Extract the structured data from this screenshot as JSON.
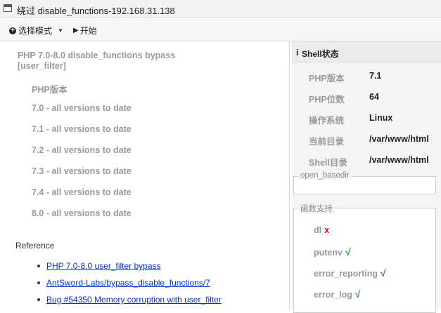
{
  "window": {
    "title": "绕过 disable_functions-192.168.31.138"
  },
  "toolbar": {
    "mode_label": "选择模式",
    "start_label": "开始"
  },
  "left": {
    "plugin_title": "PHP 7.0-8.0 disable_functions bypass [user_filter]",
    "php_version_label": "PHP版本",
    "versions": [
      "7.0 - all versions to date",
      "7.1 - all versions to date",
      "7.2 - all versions to date",
      "7.3 - all versions to date",
      "7.4 - all versions to date",
      "8.0 - all versions to date"
    ],
    "reference_label": "Reference",
    "references": [
      "PHP 7.0-8.0 user_filter bypass",
      "AntSword-Labs/bypass_disable_functions/7",
      "Bug #54350 Memory corruption with user_filter"
    ]
  },
  "right": {
    "header": "Shell状态",
    "info": [
      {
        "label": "PHP版本",
        "value": "7.1"
      },
      {
        "label": "PHP位数",
        "value": "64"
      },
      {
        "label": "操作系统",
        "value": "Linux"
      },
      {
        "label": "当前目录",
        "value": "/var/www/html"
      },
      {
        "label": "Shell目录",
        "value": "/var/www/html"
      }
    ],
    "open_basedir_legend": "open_basedir",
    "open_basedir_value": "",
    "functions_legend": "函数支持",
    "functions": [
      {
        "name": "dl",
        "mark": "x"
      },
      {
        "name": "putenv",
        "mark": "√"
      },
      {
        "name": "error_reporting",
        "mark": "√"
      },
      {
        "name": "error_log",
        "mark": "√"
      }
    ]
  },
  "colors": {
    "link": "#0033cc",
    "unsupported": "#dd0000",
    "supported": "#2a9d2a",
    "muted_label": "#999999"
  }
}
